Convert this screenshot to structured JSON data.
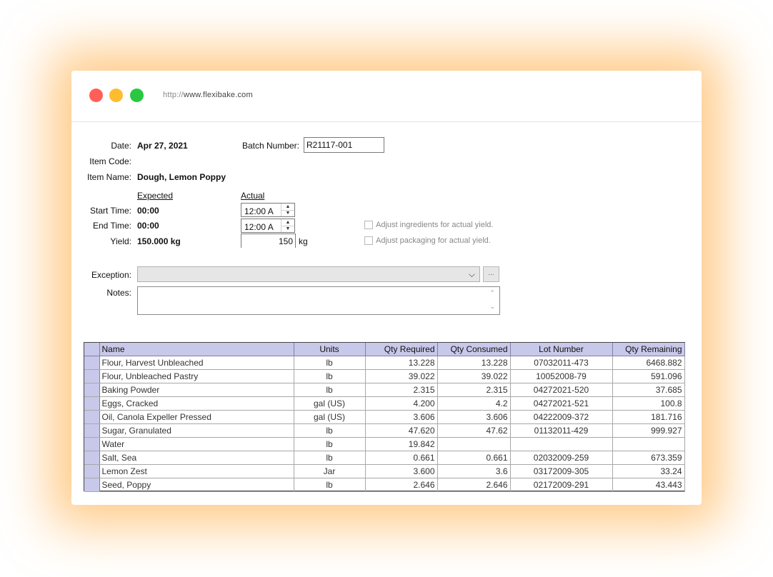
{
  "browser": {
    "url_protocol": "http://",
    "url_host": "www.flexibake.com"
  },
  "form": {
    "date_label": "Date:",
    "date_value": "Apr 27, 2021",
    "item_code_label": "Item Code:",
    "item_code_value": "",
    "item_name_label": "Item Name:",
    "item_name_value": "Dough, Lemon Poppy",
    "batch_label": "Batch Number:",
    "batch_value": "R21117-001",
    "expected_header": "Expected",
    "actual_header": "Actual",
    "start_label": "Start Time:",
    "start_expected": "00:00",
    "start_actual": "12:00 A",
    "end_label": "End Time:",
    "end_expected": "00:00",
    "end_actual": "12:00 A",
    "yield_label": "Yield:",
    "yield_expected": "150.000 kg",
    "yield_actual": "150",
    "yield_unit": "kg",
    "adjust_ingredients": "Adjust ingredients for actual yield.",
    "adjust_packaging": "Adjust packaging for actual yield.",
    "exception_label": "Exception:",
    "exception_value": "",
    "exception_button": "...",
    "notes_label": "Notes:",
    "notes_value": ""
  },
  "table": {
    "columns": [
      "Name",
      "Units",
      "Qty Required",
      "Qty Consumed",
      "Lot Number",
      "Qty Remaining"
    ],
    "rows": [
      [
        "Flour, Harvest Unbleached",
        "lb",
        "13.228",
        "13.228",
        "07032011-473",
        "6468.882"
      ],
      [
        "Flour, Unbleached Pastry",
        "lb",
        "39.022",
        "39.022",
        "10052008-79",
        "591.096"
      ],
      [
        "Baking Powder",
        "lb",
        "2.315",
        "2.315",
        "04272021-520",
        "37.685"
      ],
      [
        "Eggs, Cracked",
        "gal (US)",
        "4.200",
        "4.2",
        "04272021-521",
        "100.8"
      ],
      [
        "Oil, Canola Expeller Pressed",
        "gal (US)",
        "3.606",
        "3.606",
        "04222009-372",
        "181.716"
      ],
      [
        "Sugar, Granulated",
        "lb",
        "47.620",
        "47.62",
        "01132011-429",
        "999.927"
      ],
      [
        "Water",
        "lb",
        "19.842",
        "",
        "",
        ""
      ],
      [
        "Salt, Sea",
        "lb",
        "0.661",
        "0.661",
        "02032009-259",
        "673.359"
      ],
      [
        "Lemon Zest",
        "Jar",
        "3.600",
        "3.6",
        "03172009-305",
        "33.24"
      ],
      [
        "Seed, Poppy",
        "lb",
        "2.646",
        "2.646",
        "02172009-291",
        "43.443"
      ]
    ]
  }
}
